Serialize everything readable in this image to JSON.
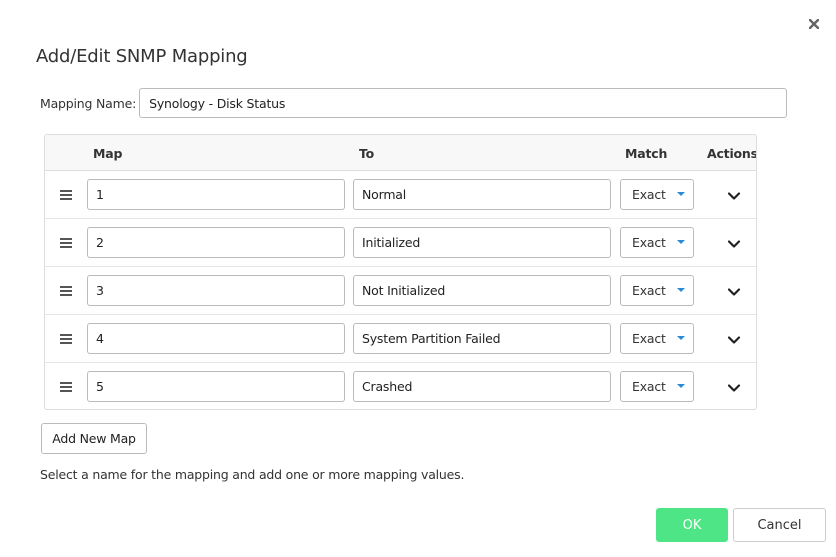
{
  "dialog": {
    "title": "Add/Edit SNMP Mapping",
    "close_icon": "close-icon"
  },
  "mapping_name": {
    "label": "Mapping Name:",
    "value": "Synology - Disk Status"
  },
  "table": {
    "headers": {
      "map": "Map",
      "to": "To",
      "match": "Match",
      "actions": "Actions"
    },
    "rows": [
      {
        "map": "1",
        "to": "Normal",
        "match": "Exact"
      },
      {
        "map": "2",
        "to": "Initialized",
        "match": "Exact"
      },
      {
        "map": "3",
        "to": "Not Initialized",
        "match": "Exact"
      },
      {
        "map": "4",
        "to": "System Partition Failed",
        "match": "Exact"
      },
      {
        "map": "5",
        "to": "Crashed",
        "match": "Exact"
      }
    ]
  },
  "add_button_label": "Add New Map",
  "help_text": "Select a name for the mapping and add one or more mapping values.",
  "footer": {
    "ok_label": "OK",
    "cancel_label": "Cancel"
  },
  "colors": {
    "ok_button": "#4de585",
    "select_caret": "#2a8ad6"
  }
}
